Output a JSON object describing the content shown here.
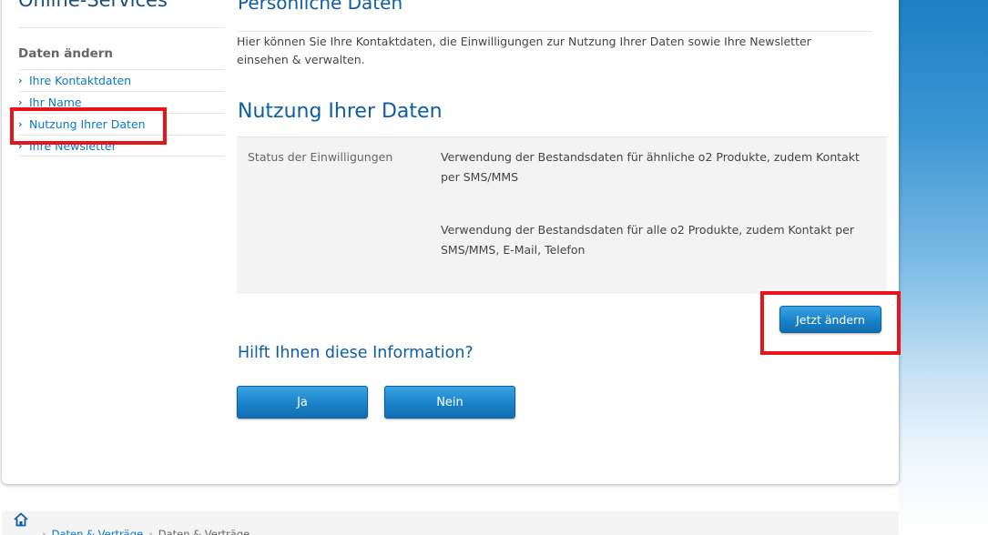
{
  "sidebar": {
    "title": "Online-Services",
    "section": "Daten ändern",
    "items": [
      {
        "label": "Ihre Kontaktdaten"
      },
      {
        "label": "Ihr Name"
      },
      {
        "label": "Nutzung Ihrer Daten"
      },
      {
        "label": "Ihre Newsletter"
      }
    ]
  },
  "main": {
    "page_title": "Persönliche Daten",
    "intro": "Hier können Sie Ihre Kontaktdaten, die Einwilligungen zur Nutzung Ihrer Daten sowie Ihre Newsletter einsehen & verwalten.",
    "section_title": "Nutzung Ihrer Daten",
    "consent": {
      "label": "Status der Einwilligungen",
      "items": [
        "Verwendung der Bestandsdaten für ähnliche o2 Produkte, zudem Kontakt per SMS/MMS",
        "Verwendung der Bestandsdaten für alle o2 Produkte, zudem Kontakt per SMS/MMS, E-Mail, Telefon"
      ]
    },
    "change_button": "Jetzt ändern",
    "help_question": "Hilft Ihnen diese Information?",
    "yes_button": "Ja",
    "no_button": "Nein"
  },
  "breadcrumb": {
    "items": [
      "Daten & Verträge",
      "Daten & Verträge"
    ]
  },
  "colors": {
    "accent": "#0d5ea6",
    "link": "#0b79c4",
    "highlight": "#e8141b"
  }
}
